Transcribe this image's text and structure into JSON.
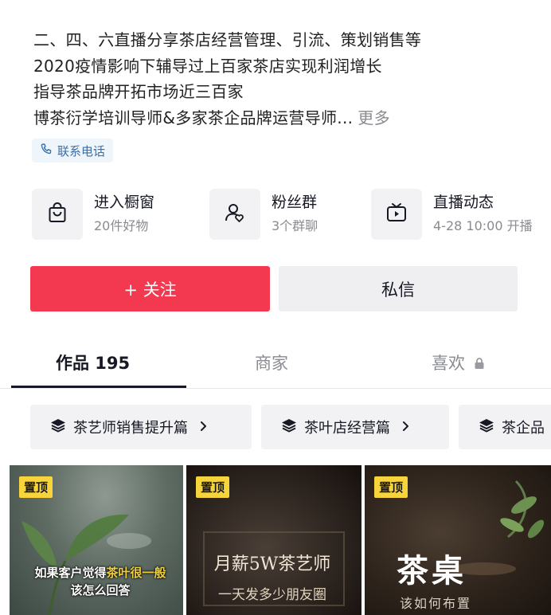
{
  "profile": {
    "bio_lines": [
      "二、四、六直播分享茶店经营管理、引流、策划销售等",
      "2020疫情影响下辅导过上百家茶店实现利润增长",
      "指导茶品牌开拓市场近三百家",
      "博茶衍学培训导师&多家茶企品牌运营导师..."
    ],
    "more_label": "更多",
    "contact_label": "联系电话"
  },
  "quick_actions": [
    {
      "title": "进入橱窗",
      "subtitle": "20件好物",
      "icon": "shopping-bag-icon"
    },
    {
      "title": "粉丝群",
      "subtitle": "3个群聊",
      "icon": "fan-group-icon"
    },
    {
      "title": "直播动态",
      "subtitle": "4-28 10:00 开播",
      "icon": "tv-live-icon"
    }
  ],
  "actions": {
    "follow_label": "+ 关注",
    "message_label": "私信"
  },
  "tabs": [
    {
      "label": "作品 195",
      "active": true
    },
    {
      "label": "商家",
      "active": false
    },
    {
      "label": "喜欢",
      "active": false,
      "locked": true
    }
  ],
  "collections": [
    {
      "label": "茶艺师销售提升篇"
    },
    {
      "label": "茶叶店经营篇"
    },
    {
      "label": "茶企品"
    }
  ],
  "videos": [
    {
      "badge": "置顶",
      "caption_line1_a": "如果客户觉得",
      "caption_line1_hl": "茶叶很一般",
      "caption_line2": "该怎么回答"
    },
    {
      "badge": "置顶",
      "caption_line1": "月薪5W茶艺师",
      "caption_line2": "一天发多少朋友圈"
    },
    {
      "badge": "置顶",
      "caption_line1": "茶桌",
      "caption_line2": "该如何布置"
    }
  ],
  "colors": {
    "follow_red": "#f2394f",
    "link_blue": "#3b6fa8",
    "pin_yellow": "#f7d43b"
  }
}
